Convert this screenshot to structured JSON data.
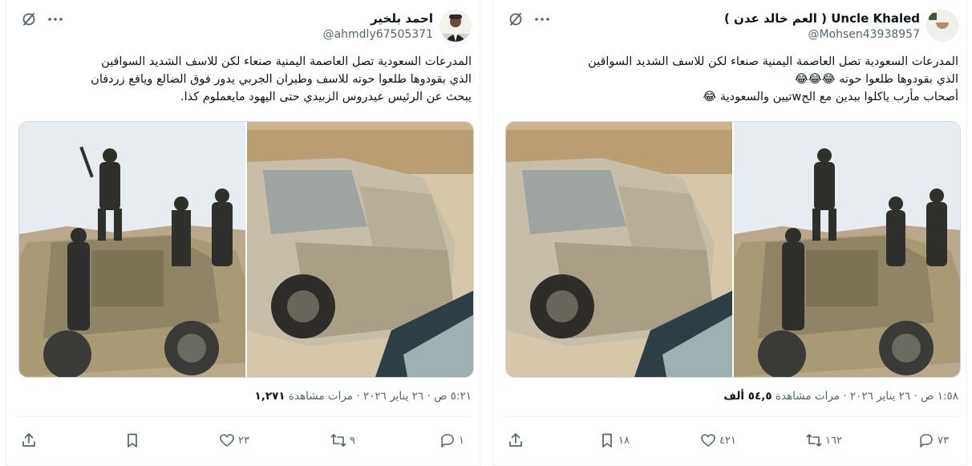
{
  "tweets": {
    "left": {
      "display_name": "احمد بلخير",
      "handle": "@ahmdly67505371",
      "text": "المدرعات السعودية تصل العاصمة اليمنية صنعاء لكن للاسف الشديد السواقين\nالذي بقودوها طلعوا حوته للاسف وطيران الجربي يدور فوق الضالع ويافع زردفان\nيبحث عن الرئيس عيدروس الزبيدي حتى اليهود مايعملوم كذا.",
      "time": "٥:٢١ ص",
      "date": "٢٦ يناير ٢٠٢٦",
      "views_count": "١,٢٧١",
      "views_label": "مرات مشاهدة",
      "replies": "١",
      "reposts": "٩",
      "likes": "٢٣",
      "bookmarks": ""
    },
    "right": {
      "display_name": "Uncle Khaled ( العم خالد عدن )",
      "handle": "@Mohsen43938957",
      "text": "المدرعات السعودية تصل العاصمة اليمنية صنعاء لكن للاسف الشديد السواقين\nالذي بقودوها طلعوا حوته 😂😂😂\nأصحاب مأرب ياكلوا ببدين مع الحwتيين والسعودية 😂",
      "time": "١:٥٨ ص",
      "date": "٢٦ يناير ٢٠٢٦",
      "views_count": "٥٤,٥ ألف",
      "views_label": "مرات مشاهدة",
      "replies": "٧٣",
      "reposts": "١٦٢",
      "likes": "٤٢١",
      "bookmarks": "١٨"
    }
  },
  "separator": "·",
  "icons": {
    "more": "more-dots-icon",
    "grok": "grok-slash-icon",
    "reply": "reply-bubble-icon",
    "repost": "repost-arrows-icon",
    "like": "heart-icon",
    "bookmark": "bookmark-icon",
    "share": "share-upload-icon"
  },
  "colors": {
    "text_primary": "#0f1419",
    "text_secondary": "#536471",
    "border": "#eff3f4"
  }
}
